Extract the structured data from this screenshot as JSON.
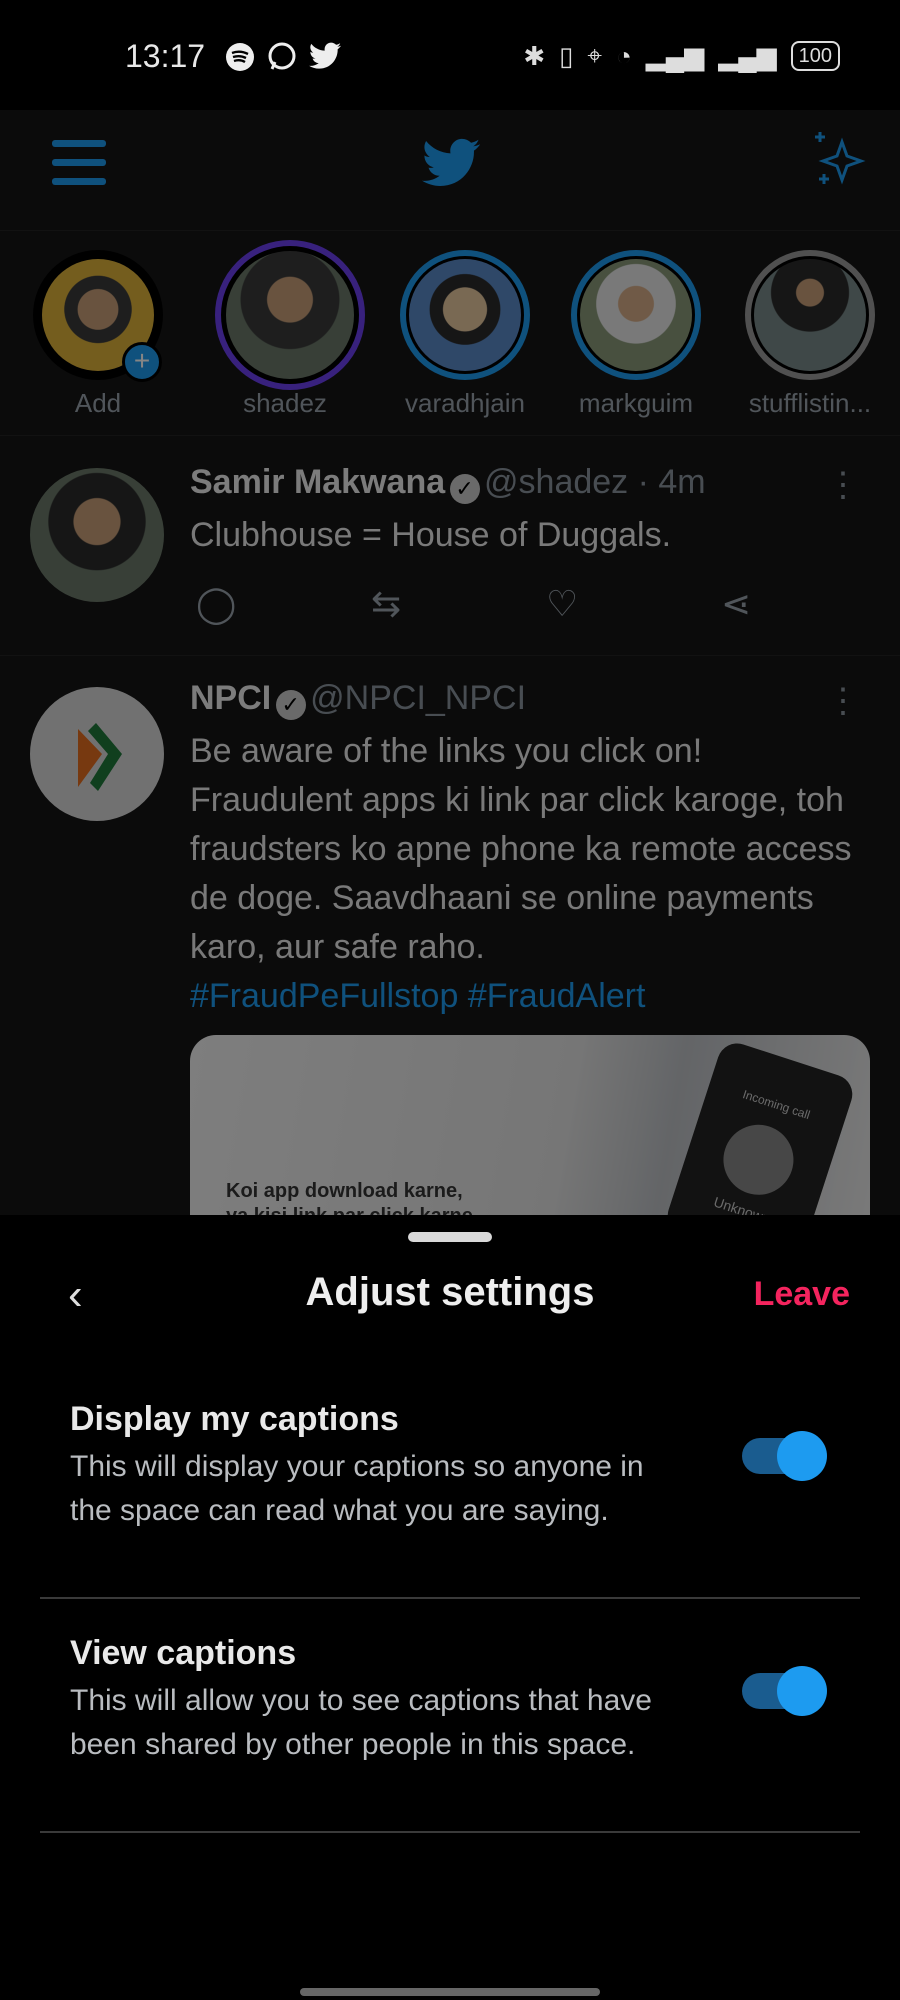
{
  "status_bar": {
    "time": "13:17",
    "battery": "100"
  },
  "fleets": [
    {
      "label": "Add"
    },
    {
      "label": "shadez"
    },
    {
      "label": "varadhjain"
    },
    {
      "label": "markguim"
    },
    {
      "label": "stufflistin..."
    }
  ],
  "tweets": [
    {
      "name": "Samir Makwana",
      "handle": "@shadez · 4m",
      "text": "Clubhouse = House of Duggals."
    },
    {
      "name": "NPCI",
      "handle": "@NPCI_NPCI",
      "text": "Be aware of the links you click on! Fraudulent apps ki link par click karoge, toh fraudsters ko apne phone ka remote access de doge. Saavdhaani se online payments karo, aur safe raho.",
      "hashtags": "#FraudPeFullstop #FraudAlert",
      "media_text": "Koi app download karne,",
      "media_text2": "ya kisi link par click karne",
      "media_phone_label": "Unknown",
      "media_phone_status": "Incoming call"
    }
  ],
  "sheet": {
    "title": "Adjust settings",
    "leave_label": "Leave",
    "settings": [
      {
        "title": "Display my captions",
        "description": "This will display your captions so anyone in the space can read what you are saying.",
        "enabled": true
      },
      {
        "title": "View captions",
        "description": "This will allow you to see captions that have been shared by other people in this space.",
        "enabled": true
      }
    ]
  },
  "colors": {
    "accent": "#1d9bf0",
    "leave": "#f4245e",
    "background": "#000000"
  }
}
